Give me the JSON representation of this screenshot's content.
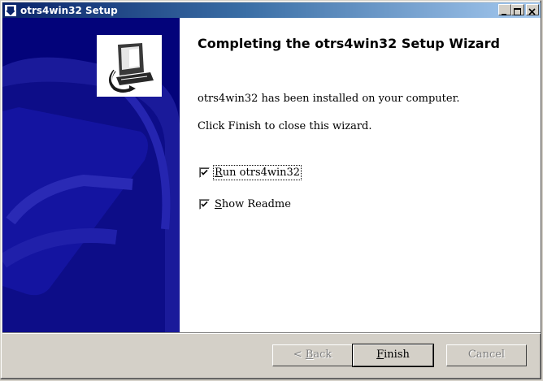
{
  "window": {
    "title": "otrs4win32 Setup",
    "title_icon": "installer-icon",
    "controls": [
      "minimize-icon",
      "maximize-icon",
      "close-icon"
    ]
  },
  "wizard": {
    "heading": "Completing the otrs4win32 Setup Wizard",
    "installed_text": "otrs4win32 has been installed on your computer.",
    "close_text": "Click Finish to close this wizard.",
    "options": [
      {
        "label_first": "R",
        "label_rest": "un otrs4win32",
        "checked": true
      },
      {
        "label_first": "S",
        "label_rest": "how Readme",
        "checked": true
      }
    ]
  },
  "buttons": {
    "back_prefix": "< ",
    "back_key": "B",
    "back_rest": "ack",
    "finish_key": "F",
    "finish_rest": "inish",
    "cancel": "Cancel"
  },
  "colors": {
    "side_panel": "#03037a",
    "titlebar_start": "#0a246a",
    "face": "#d4d0c8"
  }
}
